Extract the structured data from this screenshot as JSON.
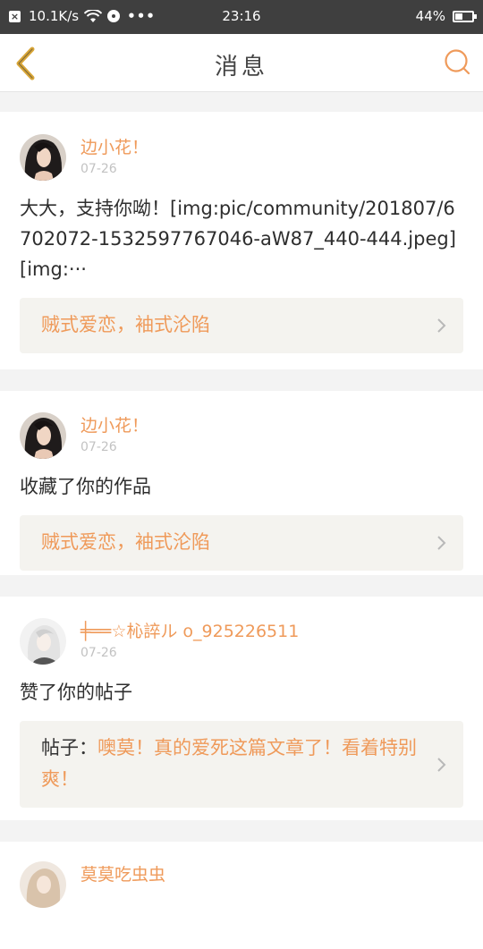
{
  "status_bar": {
    "speed": "10.1K/s",
    "dots": "•••",
    "time": "23:16",
    "battery": "44%",
    "battery_level": 0.44
  },
  "header": {
    "title": "消息"
  },
  "messages": [
    {
      "username": "边小花！",
      "date": "07-26",
      "text": "大大，支持你呦！[img:pic/community/201807/6702072-1532597767046-aW87_440-444.jpeg] [img:···",
      "ref_prefix": "",
      "ref_title": "贼式爱恋，袖式沦陷"
    },
    {
      "username": "边小花！",
      "date": "07-26",
      "text": "收藏了你的作品",
      "ref_prefix": "",
      "ref_title": "贼式爱恋，袖式沦陷"
    },
    {
      "username": "╪══☆杺誶ル o_925226511",
      "date": "07-26",
      "text": "赞了你的帖子",
      "ref_prefix": "帖子：",
      "ref_title": "噢莫！真的爱死这篇文章了！看着特别爽！"
    },
    {
      "username": "莫莫吃虫虫",
      "date": "",
      "text": "",
      "ref_prefix": "",
      "ref_title": ""
    }
  ],
  "colors": {
    "accent": "#ef9a5a",
    "back_arrow": "#d9a637",
    "status_bar_bg": "#3f3f3f"
  }
}
